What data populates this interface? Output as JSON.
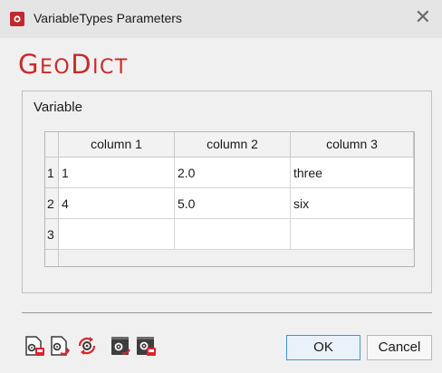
{
  "window": {
    "title": "VariableTypes Parameters",
    "close_glyph": "✕",
    "app_icon": "geodict-app-icon"
  },
  "logo": {
    "g": "G",
    "eo": "EO",
    "d": "D",
    "ict": "ICT"
  },
  "group": {
    "label": "Variable"
  },
  "table": {
    "columns": [
      "column 1",
      "column 2",
      "column 3"
    ],
    "rows": [
      {
        "num": "1",
        "cells": [
          "1",
          "2.0",
          "three"
        ]
      },
      {
        "num": "2",
        "cells": [
          "4",
          "5.0",
          "six"
        ]
      },
      {
        "num": "3",
        "cells": [
          "",
          "",
          ""
        ]
      }
    ]
  },
  "toolbar_icons": [
    "load-settings-icon",
    "save-settings-icon",
    "reset-settings-icon",
    "load-macro-icon",
    "save-macro-icon"
  ],
  "buttons": {
    "ok": "OK",
    "cancel": "Cancel"
  },
  "colors": {
    "brand_red": "#c72b2b",
    "ok_border": "#4a8fd6"
  }
}
